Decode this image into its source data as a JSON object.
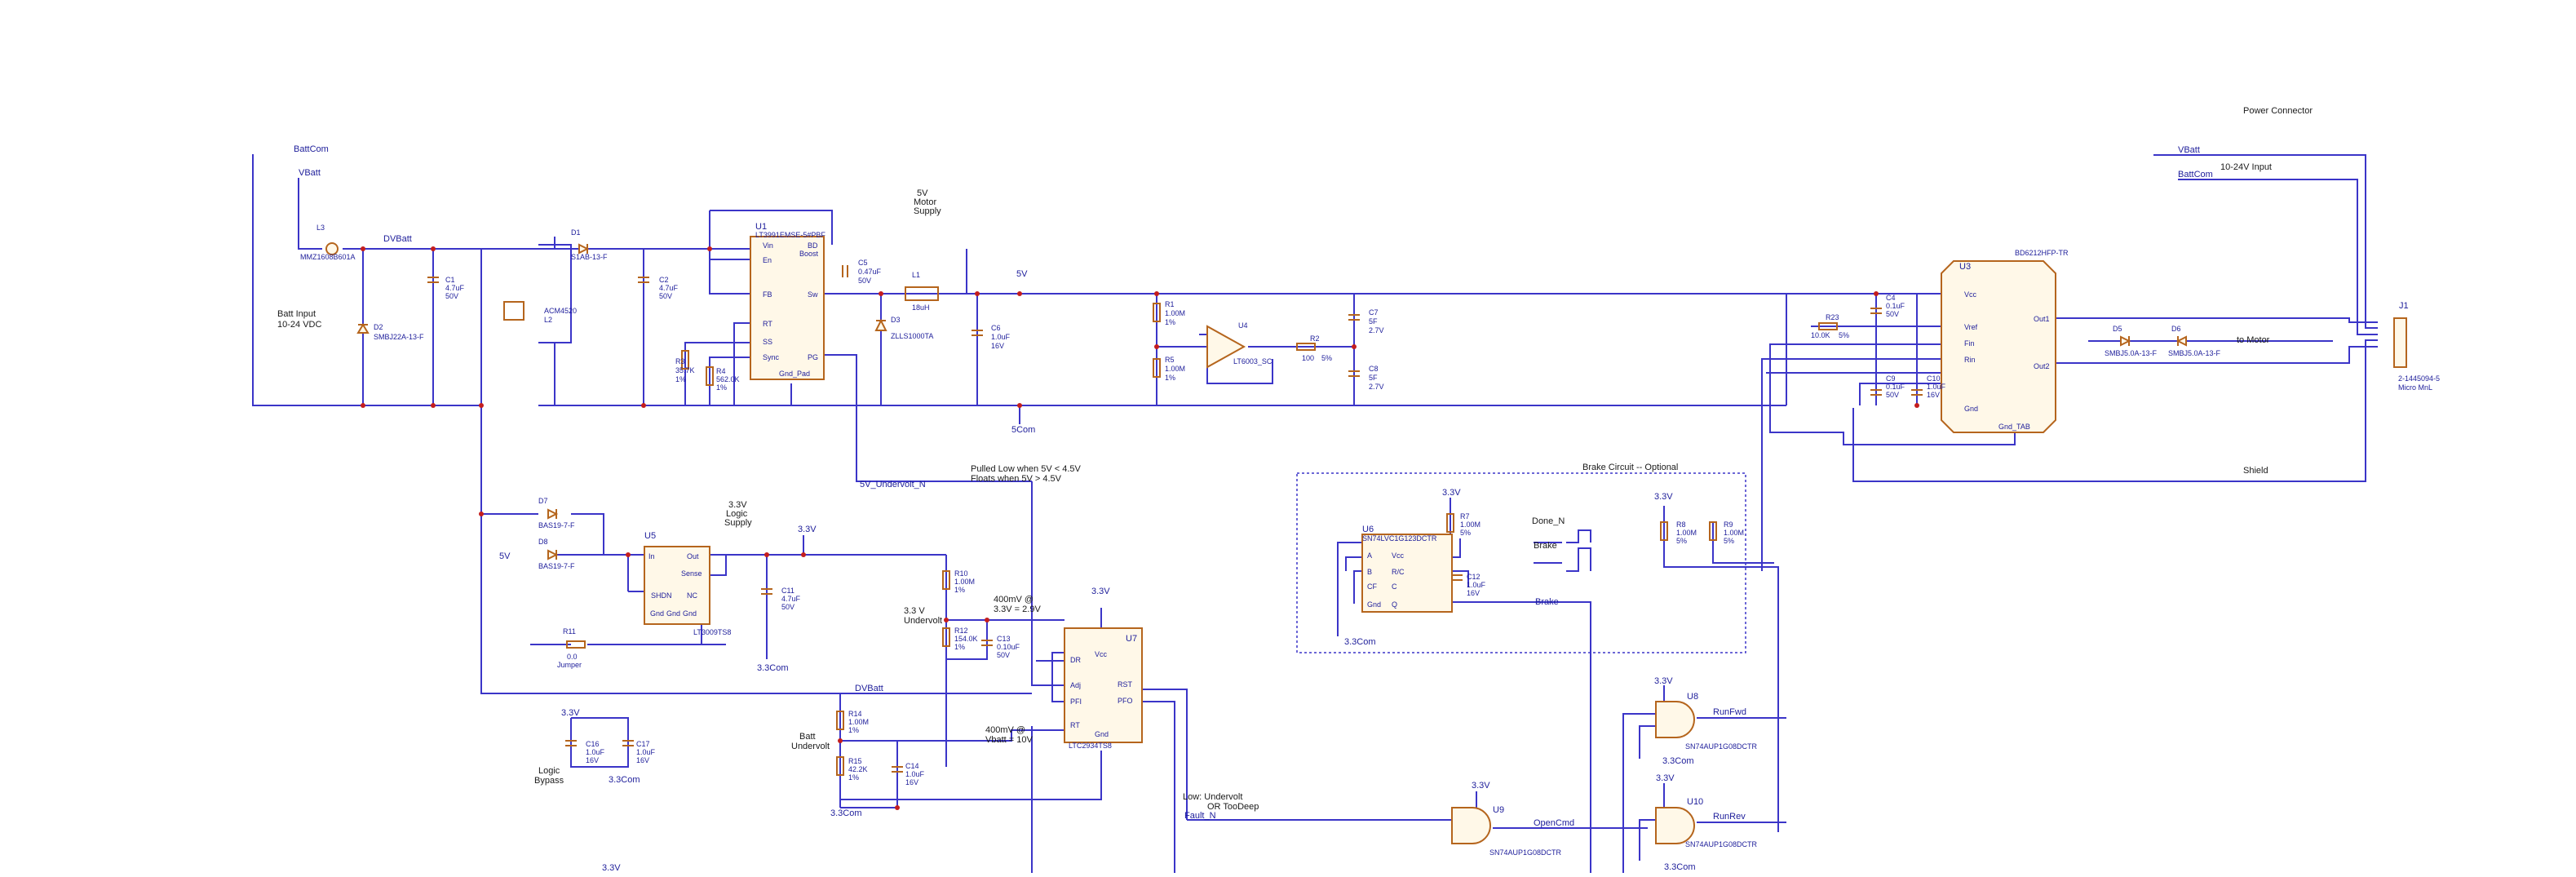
{
  "sheet": {
    "header": {
      "power_connector": "Power Connector"
    },
    "nets": {
      "battcom": "BattCom",
      "vbatt": "VBatt",
      "dvbatt": "DVBatt",
      "v5": "5V",
      "v5com": "5Com",
      "v33": "3.3V",
      "v33com": "3.3Com",
      "undervolt": "5V_Undervolt_N",
      "faultn": "Fault_N",
      "runfwd": "RunFwd",
      "runrev": "RunRev",
      "opencmd": "OpenCmd",
      "done": "Done_N",
      "brake": "Brake",
      "shield": "Shield",
      "to_motor": "to Motor",
      "vbatt2": "VBatt",
      "battcom2": "BattCom",
      "range_label": "10-24V Input"
    },
    "notes": {
      "batt_input": [
        "Batt Input",
        "10-24 VDC"
      ],
      "motor_supply": [
        "5V",
        "Motor",
        "Supply"
      ],
      "logic_supply": [
        "3.3V",
        "Logic",
        "Supply"
      ],
      "pulled": [
        "Pulled Low when 5V < 4.5V",
        "Floats when 5V > 4.5V"
      ],
      "undervolt33": [
        "3.3 V",
        "Undervolt"
      ],
      "v400a": [
        "400mV @",
        "3.3V = 2.9V"
      ],
      "v400b": [
        "400mV @",
        "Vbatt = 10V"
      ],
      "batt_undervolt": [
        "Batt",
        "Undervolt"
      ],
      "low_undervolt": [
        "Low:  Undervolt",
        "OR TooDeep"
      ],
      "logic_bypass": [
        "Logic",
        "Bypass"
      ],
      "brake_circuit": "Brake Circuit -- Optional"
    },
    "parts": {
      "L3": [
        "L3",
        "MMZ1608B601A"
      ],
      "D2": [
        "D2",
        "SMBJ22A-13-F"
      ],
      "C1": [
        "C1",
        "4.7uF",
        "50V"
      ],
      "L2": [
        "ACM4520",
        "L2"
      ],
      "D1": [
        "D1",
        "S1AB-13-F"
      ],
      "C2": [
        "C2",
        "4.7uF",
        "50V"
      ],
      "U1": [
        "U1",
        "LT3991EMSE-5#PBF"
      ],
      "R3": [
        "R3",
        "35.7K",
        "1%"
      ],
      "R4": [
        "R4",
        "562.0K",
        "1%"
      ],
      "C5": [
        "C5",
        "0.47uF",
        "50V"
      ],
      "L1": [
        "L1",
        "18uH"
      ],
      "D3": [
        "D3",
        "ZLLS1000TA"
      ],
      "C6": [
        "C6",
        "1.0uF",
        "16V"
      ],
      "R1": [
        "R1",
        "1.00M",
        "1%"
      ],
      "R5": [
        "R5",
        "1.00M",
        "1%"
      ],
      "U4": [
        "U4",
        "LT6003_SC"
      ],
      "R2": [
        "R2",
        "100",
        "5%"
      ],
      "C7": [
        "C7",
        "5F",
        "2.7V"
      ],
      "C8": [
        "C8",
        "5F",
        "2.7V"
      ],
      "R23": [
        "R23",
        "10.0K",
        "5%"
      ],
      "C4": [
        "C4",
        "0.1uF",
        "50V"
      ],
      "C9": [
        "C9",
        "0.1uF",
        "50V"
      ],
      "C10": [
        "C10",
        "1.0uF",
        "16V"
      ],
      "U3": [
        "U3",
        "BD6212HFP-TR"
      ],
      "D5": [
        "D5",
        "SMBJ5.0A-13-F"
      ],
      "D6": [
        "D6",
        "SMBJ5.0A-13-F"
      ],
      "J1": [
        "J1",
        "2-1445094-5",
        "Micro MnL"
      ],
      "D7": [
        "D7",
        "BAS19-7-F"
      ],
      "D8": [
        "D8",
        "BAS19-7-F"
      ],
      "U5": [
        "U5",
        "LT3009TS8"
      ],
      "R11": [
        "R11",
        "0.0",
        "Jumper"
      ],
      "C11": [
        "C11",
        "4.7uF",
        "50V"
      ],
      "R10": [
        "R10",
        "1.00M",
        "1%"
      ],
      "R12": [
        "R12",
        "154.0K",
        "1%"
      ],
      "C13": [
        "C13",
        "0.10uF",
        "50V"
      ],
      "U7": [
        "U7",
        "LTC2934TS8"
      ],
      "R14": [
        "R14",
        "1.00M",
        "1%"
      ],
      "R15": [
        "R15",
        "42.2K",
        "1%"
      ],
      "C14": [
        "C14",
        "1.0uF",
        "16V"
      ],
      "C16": [
        "C16",
        "1.0uF",
        "16V"
      ],
      "C17": [
        "C17",
        "1.0uF",
        "16V"
      ],
      "U6": [
        "U6",
        "SN74LVC1G123DCTR"
      ],
      "R7": [
        "R7",
        "1.00M",
        "5%"
      ],
      "C12": [
        "C12",
        "1.0uF",
        "16V"
      ],
      "R8": [
        "R8",
        "1.00M",
        "5%"
      ],
      "R9": [
        "R9",
        "1.00M",
        "5%"
      ],
      "U8": [
        "U8",
        "SN74AUP1G08DCTR"
      ],
      "U9": [
        "U9",
        "SN74AUP1G08DCTR"
      ],
      "U10": [
        "U10",
        "SN74AUP1G08DCTR"
      ]
    },
    "pins": {
      "u1": [
        "Vin",
        "En",
        "FB",
        "RT",
        "SS",
        "Sync",
        "BD",
        "Boost",
        "Sw",
        "PG",
        "Gnd_Pad"
      ],
      "u3": [
        "Vcc",
        "Vref",
        "Fin",
        "Rin",
        "Gnd",
        "Gnd_TAB",
        "Out1",
        "Out2"
      ],
      "u5": [
        "In",
        "SHDN",
        "Out",
        "Sense",
        "NC",
        "Gnd",
        "Gnd",
        "Gnd"
      ],
      "u7": [
        "Vcc",
        "RST",
        "PFO",
        "DR",
        "Adj",
        "PFI",
        "RT",
        "Gnd"
      ],
      "u6": [
        "A",
        "B",
        "CF",
        "Gnd",
        "Vcc",
        "R/C",
        "C",
        "Q"
      ]
    }
  }
}
